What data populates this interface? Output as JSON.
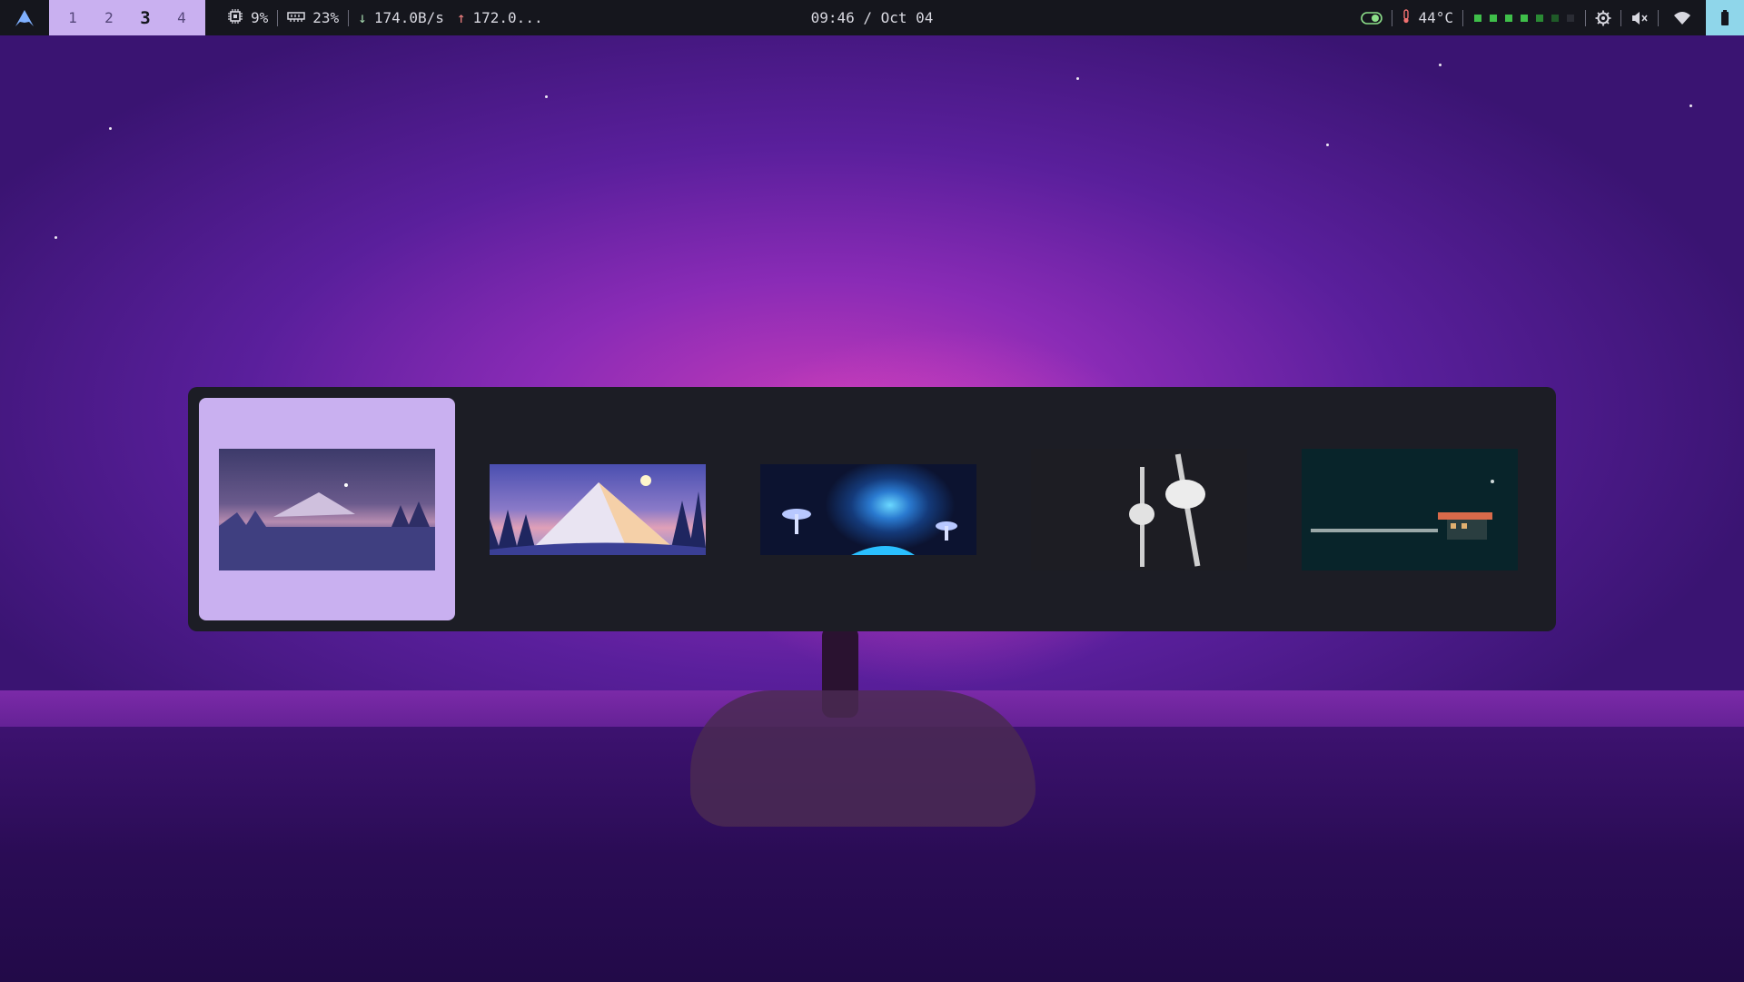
{
  "topbar": {
    "workspaces": [
      {
        "label": "1",
        "active": false
      },
      {
        "label": "2",
        "active": false
      },
      {
        "label": "3",
        "active": true
      },
      {
        "label": "4",
        "active": false
      }
    ],
    "cpu": "9%",
    "memory": "23%",
    "net_down": "174.0B/s",
    "net_up": "172.0...",
    "clock": "09:46 / Oct 04",
    "temperature": "44°C",
    "volume_state": "muted",
    "icons": [
      "arch-logo-icon",
      "cpu-icon",
      "memory-icon",
      "arrow-down-icon",
      "arrow-up-icon",
      "toggle-icon",
      "thermometer-icon",
      "gear-icon",
      "speaker-muted-icon",
      "wifi-icon",
      "battery-icon"
    ]
  },
  "switcher": {
    "selected_index": 0,
    "items": [
      {
        "name": "purple-mountain-dusk"
      },
      {
        "name": "snowy-mountain-moon"
      },
      {
        "name": "mushroom-cave"
      },
      {
        "name": "hands-with-katana"
      },
      {
        "name": "night-gas-station"
      }
    ]
  },
  "colors": {
    "bar_bg": "#15161d",
    "accent": "#c9b0f0",
    "switcher_bg": "#1c1d25",
    "battery_bg": "#8fd6ea"
  }
}
